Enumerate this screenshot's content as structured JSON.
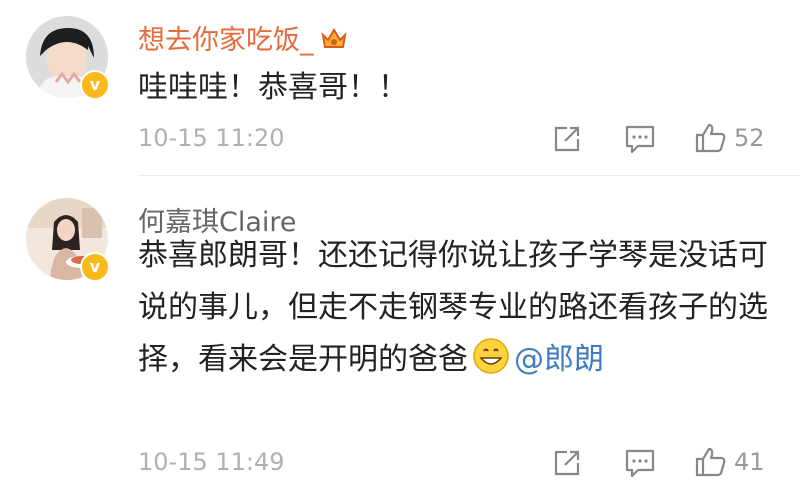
{
  "comments": [
    {
      "username": "想去你家吃饭_",
      "text": "哇哇哇！恭喜哥！！",
      "time": "10-15 11:20",
      "likes": "52",
      "verified": true,
      "vip_badge": "crown-vip-icon"
    },
    {
      "username": "何嘉琪Claire",
      "text": "恭喜郎朗哥！还还记得你说让孩子学琴是没话可说的事儿，但走不走钢琴专业的路还看孩子的选择，看来会是开明的爸爸",
      "emoji": "grinning-emoji",
      "mention": "@郎朗",
      "time": "10-15 11:49",
      "likes": "41",
      "verified": true
    }
  ],
  "icons": {
    "share": "share-icon",
    "comment": "comment-icon",
    "like": "thumbs-up-icon"
  },
  "colors": {
    "vip_name": "#e86a3a",
    "mention": "#3f7cc2",
    "verified_badge": "#f8b91b"
  }
}
